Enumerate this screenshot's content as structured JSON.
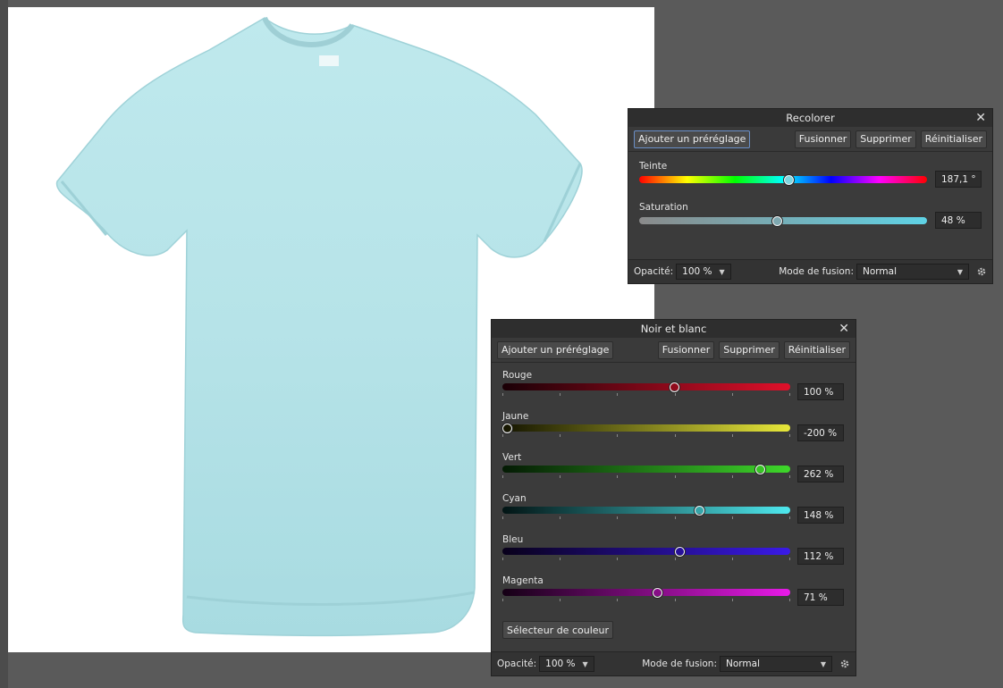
{
  "recolor": {
    "title": "Recolorer",
    "close": "✕",
    "buttons": {
      "add_preset": "Ajouter un préréglage",
      "merge": "Fusionner",
      "delete": "Supprimer",
      "reset": "Réinitialiser"
    },
    "hue": {
      "label": "Teinte",
      "value": "187,1 °",
      "fraction": 0.52
    },
    "saturation": {
      "label": "Saturation",
      "value": "48 %",
      "fraction": 0.48
    },
    "footer": {
      "opacity_label": "Opacité:",
      "opacity_value": "100 %",
      "blend_label": "Mode de fusion:",
      "blend_value": "Normal"
    }
  },
  "bw": {
    "title": "Noir et blanc",
    "close": "✕",
    "buttons": {
      "add_preset": "Ajouter un préréglage",
      "merge": "Fusionner",
      "delete": "Supprimer",
      "reset": "Réinitialiser",
      "color_picker": "Sélecteur de couleur"
    },
    "channels": [
      {
        "label": "Rouge",
        "value": "100 %",
        "fraction": 0.6,
        "from": "#1a0006",
        "to": "#e0102a"
      },
      {
        "label": "Jaune",
        "value": "-200 %",
        "fraction": 0.0,
        "from": "#141400",
        "to": "#e8e83a"
      },
      {
        "label": "Vert",
        "value": "262 %",
        "fraction": 0.91,
        "from": "#041a04",
        "to": "#3ed82a"
      },
      {
        "label": "Cyan",
        "value": "148 %",
        "fraction": 0.69,
        "from": "#021414",
        "to": "#4ee8ee"
      },
      {
        "label": "Bleu",
        "value": "112 %",
        "fraction": 0.62,
        "from": "#08001a",
        "to": "#3a1ae8"
      },
      {
        "label": "Magenta",
        "value": "71 %",
        "fraction": 0.54,
        "from": "#140014",
        "to": "#e81ae8"
      }
    ],
    "footer": {
      "opacity_label": "Opacité:",
      "opacity_value": "100 %",
      "blend_label": "Mode de fusion:",
      "blend_value": "Normal"
    }
  }
}
